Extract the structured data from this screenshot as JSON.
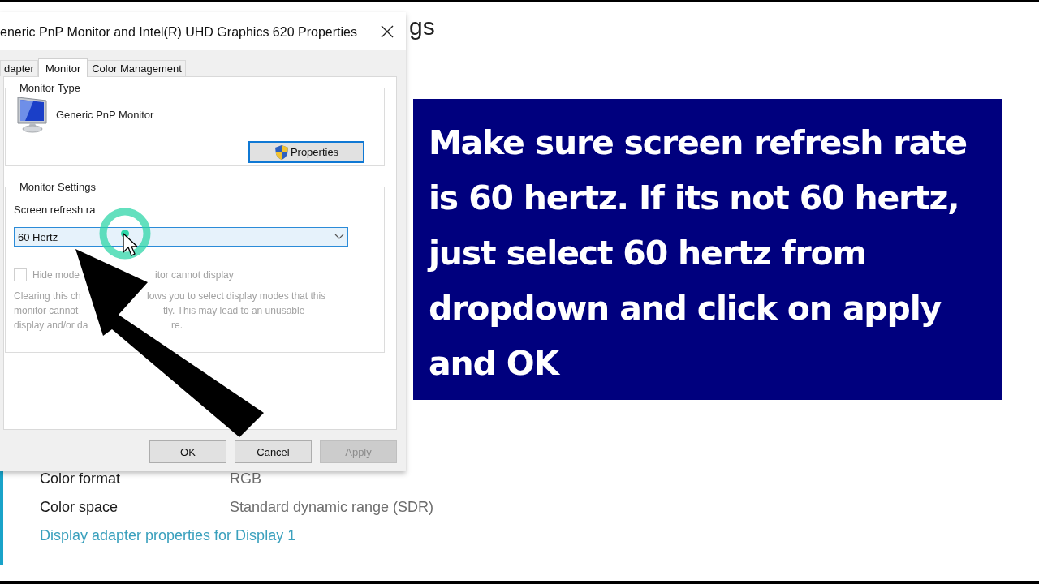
{
  "background_page": {
    "heading": "gs",
    "details": [
      {
        "label": "Color format",
        "value": "RGB"
      },
      {
        "label": "Color space",
        "value": "Standard dynamic range (SDR)"
      }
    ],
    "link": "Display adapter properties for Display 1"
  },
  "dialog": {
    "title": "eneric PnP Monitor and Intel(R) UHD Graphics 620 Properties",
    "tabs": [
      {
        "label": "dapter",
        "selected": false
      },
      {
        "label": "Monitor",
        "selected": true
      },
      {
        "label": "Color Management",
        "selected": false
      }
    ],
    "monitor_type": {
      "legend": "Monitor Type",
      "name": "Generic PnP Monitor",
      "button": "Properties"
    },
    "monitor_settings": {
      "legend": "Monitor Settings",
      "refresh_label": "Screen refresh ra",
      "refresh_value": "60 Hertz",
      "hide_modes": {
        "checked": false,
        "disabled": true,
        "label_parts": [
          "Hide mode",
          "itor cannot display"
        ]
      },
      "note_lines": [
        [
          "Clearing this ch",
          "lows you to select display modes that this"
        ],
        [
          "monitor cannot",
          "tly. This may lead to an unusable"
        ],
        [
          "display and/or da",
          "re."
        ]
      ]
    },
    "buttons": [
      {
        "label": "OK",
        "disabled": false
      },
      {
        "label": "Cancel",
        "disabled": false
      },
      {
        "label": "Apply",
        "disabled": true
      }
    ]
  },
  "caption": {
    "text": "Make sure screen refresh rate\nis 60 hertz. If its not 60 hertz,\njust select 60 hertz from\ndropdown and click on apply\nand OK"
  }
}
